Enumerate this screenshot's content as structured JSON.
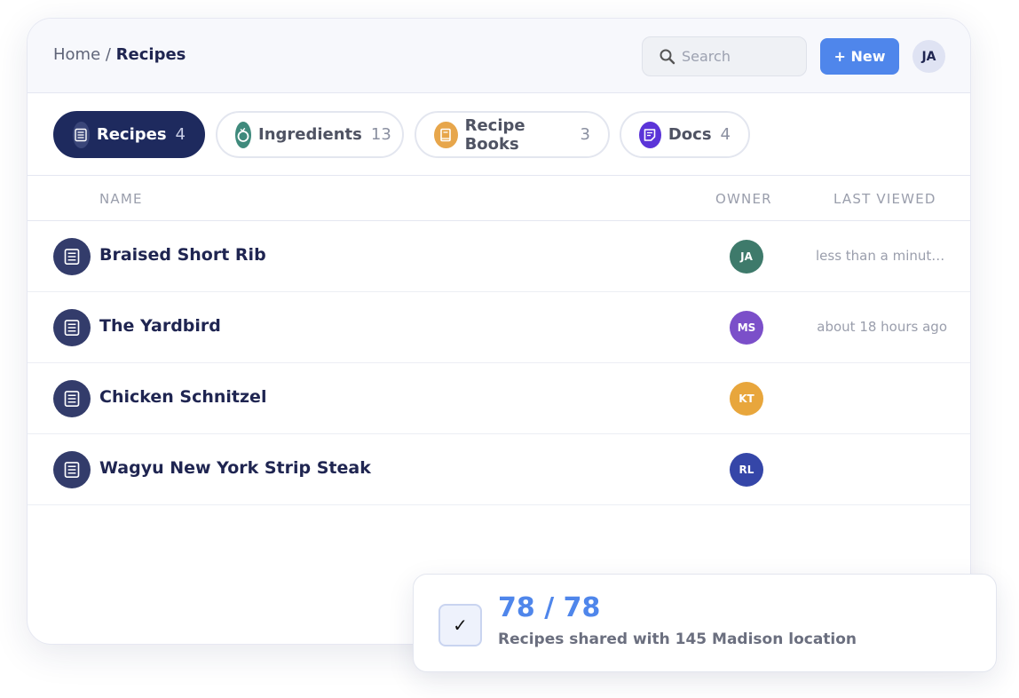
{
  "breadcrumb": {
    "parent": "Home",
    "separator": " / ",
    "current": "Recipes"
  },
  "search": {
    "placeholder": "Search",
    "icon": "search-icon"
  },
  "header": {
    "new_button": "+ New",
    "user_initials": "JA"
  },
  "colors": {
    "accent": "#4f86eb",
    "active_tab": "#1e2a5e",
    "recipe_icon": "#333c6b",
    "ingredient_icon": "#3f8a7c",
    "book_icon": "#e7a64b",
    "docs_icon": "#5b34d8"
  },
  "tabs": [
    {
      "label": "Recipes",
      "count": "4",
      "icon": "recipe-list-icon",
      "active": true
    },
    {
      "label": "Ingredients",
      "count": "13",
      "icon": "apple-icon",
      "active": false
    },
    {
      "label": "Recipe Books",
      "count": "3",
      "icon": "book-icon",
      "active": false
    },
    {
      "label": "Docs",
      "count": "4",
      "icon": "document-icon",
      "active": false
    }
  ],
  "table": {
    "columns": {
      "name": "NAME",
      "owner": "OWNER",
      "last_viewed": "LAST VIEWED"
    },
    "rows": [
      {
        "name": "Braised Short Rib",
        "owner": "JA",
        "owner_color": "#3e7a6b",
        "last_viewed": "less than a minute ago"
      },
      {
        "name": "The Yardbird",
        "owner": "MS",
        "owner_color": "#7b4fc9",
        "last_viewed": "about 18 hours ago"
      },
      {
        "name": "Chicken Schnitzel",
        "owner": "KT",
        "owner_color": "#e8a63c",
        "last_viewed": ""
      },
      {
        "name": "Wagyu New York Strip Steak",
        "owner": "RL",
        "owner_color": "#3546a8",
        "last_viewed": ""
      }
    ]
  },
  "toast": {
    "check": "✓",
    "headline": "78 / 78",
    "message": "Recipes shared with 145 Madison location"
  }
}
